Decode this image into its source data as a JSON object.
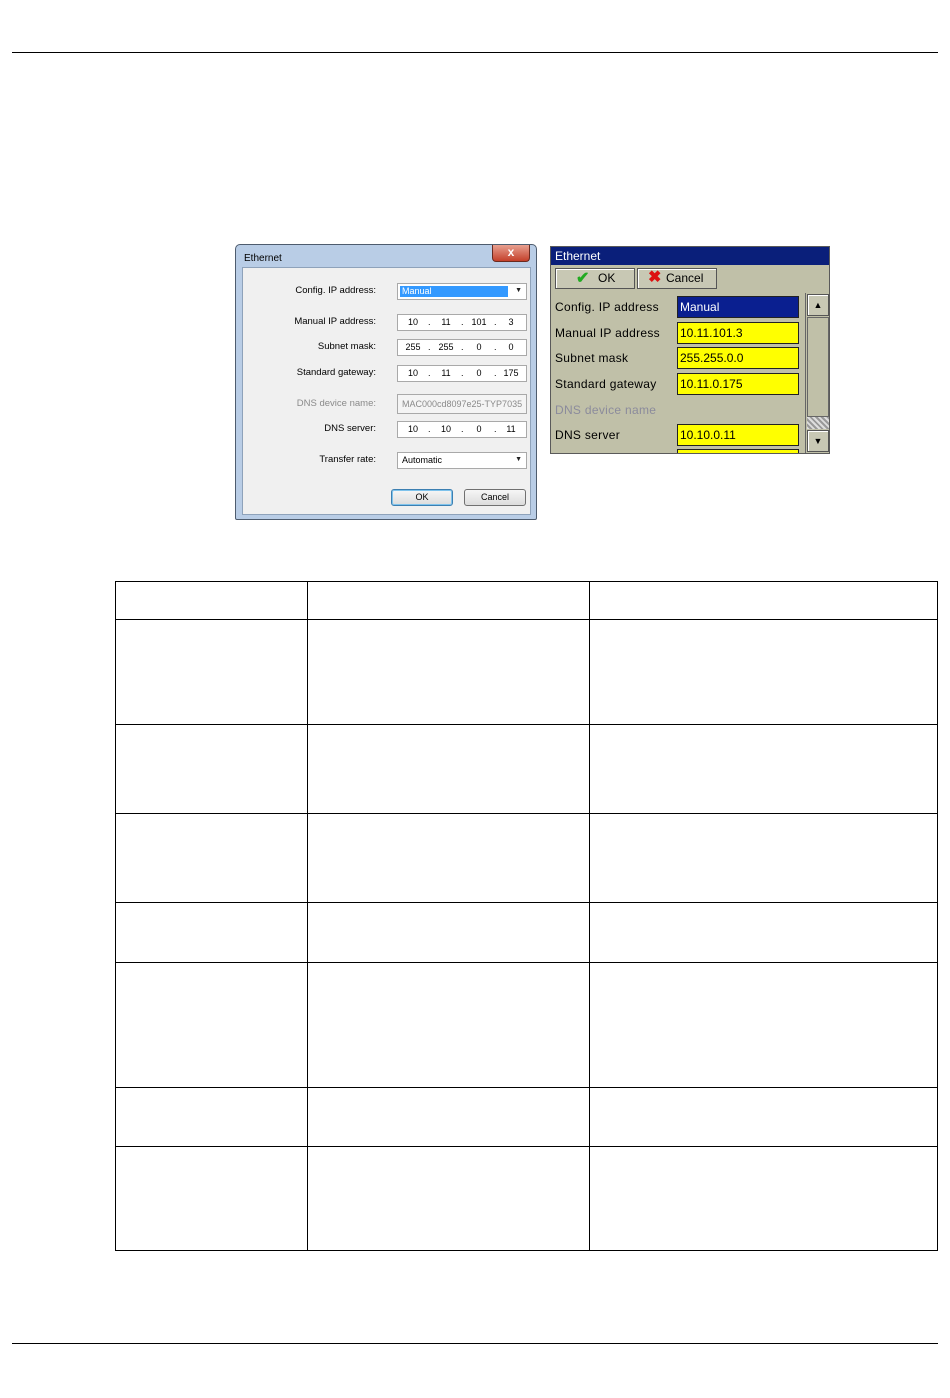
{
  "win_dialog": {
    "title": "Ethernet",
    "close_label": "x",
    "labels": {
      "config_ip": "Config. IP address:",
      "manual_ip": "Manual IP address:",
      "subnet": "Subnet mask:",
      "gateway": "Standard gateway:",
      "dns_name": "DNS device name:",
      "dns_server": "DNS server:",
      "transfer": "Transfer rate:"
    },
    "config_ip_value": "Manual",
    "manual_ip": [
      "10",
      "11",
      "101",
      "3"
    ],
    "subnet": [
      "255",
      "255",
      "0",
      "0"
    ],
    "gateway": [
      "10",
      "11",
      "0",
      "175"
    ],
    "dns_name_value": "MAC000cd8097e25-TYP7035",
    "dns_server": [
      "10",
      "10",
      "0",
      "11"
    ],
    "transfer_value": "Automatic",
    "ok_label": "OK",
    "cancel_label": "Cancel"
  },
  "dev_dialog": {
    "title": "Ethernet",
    "ok_label": "OK",
    "cancel_label": "Cancel",
    "labels": {
      "config_ip": "Config. IP address",
      "manual_ip": "Manual IP address",
      "subnet": "Subnet mask",
      "gateway": "Standard gateway",
      "dns_name": "DNS device name",
      "dns_server": "DNS server"
    },
    "config_ip_value": "Manual",
    "manual_ip_value": "10.11.101.3",
    "subnet_value": "255.255.0.0",
    "gateway_value": "10.11.0.175",
    "dns_server_value": "10.10.0.11",
    "colors": {
      "title_bar": "#0a1f7a",
      "field": "#ffff00",
      "ok_check": "#22aa22",
      "cancel_x": "#dd1111"
    }
  },
  "table": {
    "columns": 3,
    "rows": 8
  }
}
